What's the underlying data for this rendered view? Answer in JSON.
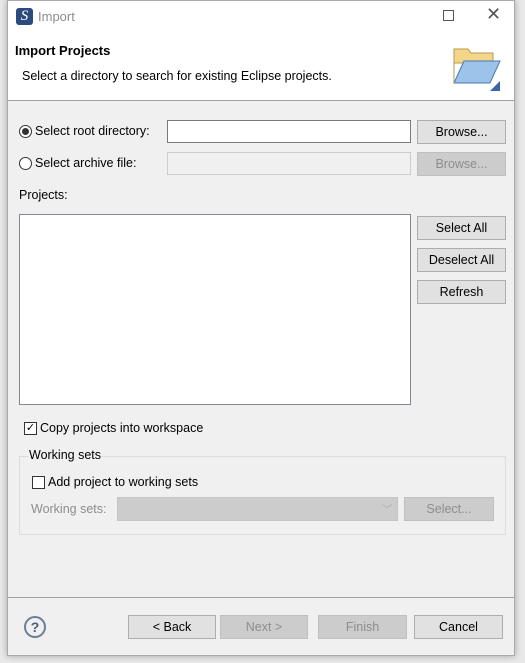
{
  "window": {
    "title": "Import",
    "app_icon": "eclipse-icon"
  },
  "header": {
    "title": "Import Projects",
    "description": "Select a directory to search for existing Eclipse projects.",
    "icon": "folder-open-icon"
  },
  "source": {
    "root_label": "Select root directory:",
    "root_value": "",
    "root_selected": true,
    "archive_label": "Select archive file:",
    "archive_value": "",
    "archive_selected": false,
    "browse_label": "Browse..."
  },
  "projects": {
    "label": "Projects:",
    "items": [],
    "select_all": "Select All",
    "deselect_all": "Deselect All",
    "refresh": "Refresh"
  },
  "options": {
    "copy_label": "Copy projects into workspace",
    "copy_checked": true
  },
  "working_sets": {
    "group_label": "Working sets",
    "add_label": "Add project to working sets",
    "add_checked": false,
    "sets_label": "Working sets:",
    "sets_value": "",
    "select_label": "Select..."
  },
  "footer": {
    "back": "< Back",
    "next": "Next >",
    "finish": "Finish",
    "cancel": "Cancel"
  }
}
